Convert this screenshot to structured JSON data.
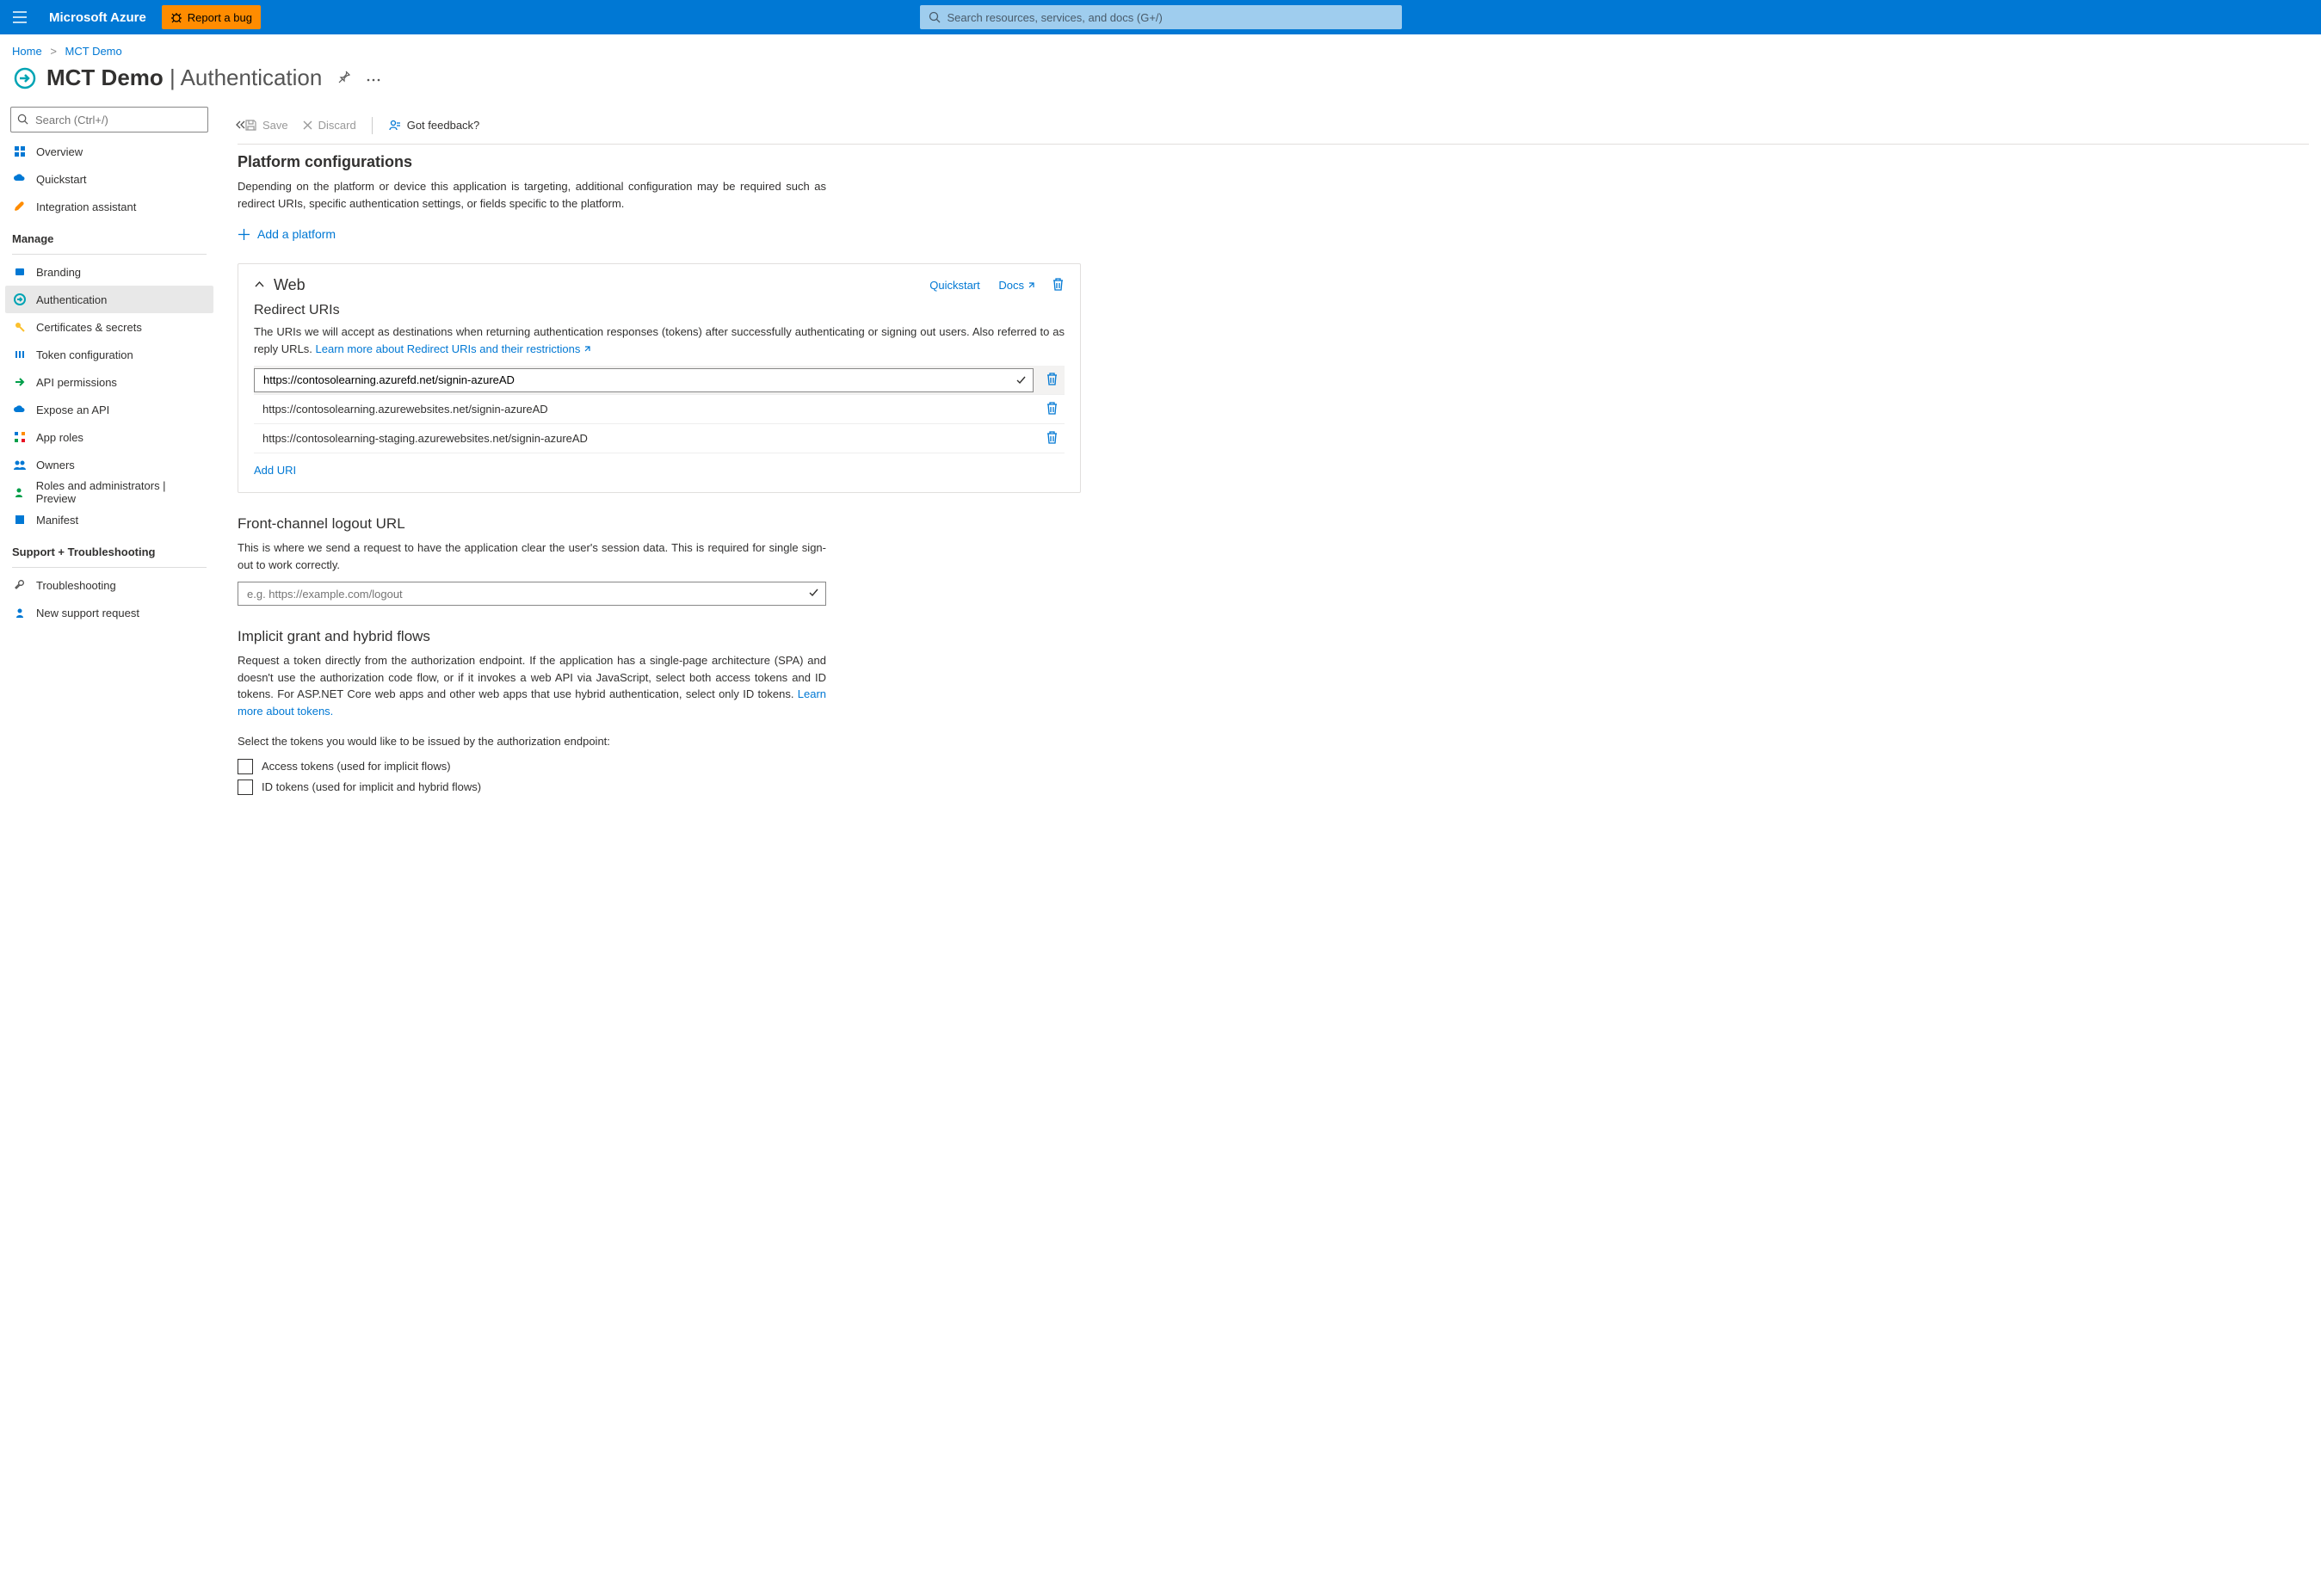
{
  "topbar": {
    "brand": "Microsoft Azure",
    "bug": "Report a bug",
    "search_ph": "Search resources, services, and docs (G+/)"
  },
  "crumbs": {
    "home": "Home",
    "page": "MCT Demo"
  },
  "header": {
    "app": "MCT Demo",
    "section": "Authentication"
  },
  "sidebar": {
    "search_ph": "Search (Ctrl+/)",
    "items_top": [
      {
        "label": "Overview"
      },
      {
        "label": "Quickstart"
      },
      {
        "label": "Integration assistant"
      }
    ],
    "group_manage": "Manage",
    "items_manage": [
      {
        "label": "Branding"
      },
      {
        "label": "Authentication"
      },
      {
        "label": "Certificates & secrets"
      },
      {
        "label": "Token configuration"
      },
      {
        "label": "API permissions"
      },
      {
        "label": "Expose an API"
      },
      {
        "label": "App roles"
      },
      {
        "label": "Owners"
      },
      {
        "label": "Roles and administrators | Preview"
      },
      {
        "label": "Manifest"
      }
    ],
    "group_support": "Support + Troubleshooting",
    "items_support": [
      {
        "label": "Troubleshooting"
      },
      {
        "label": "New support request"
      }
    ]
  },
  "cmdbar": {
    "save": "Save",
    "discard": "Discard",
    "feedback": "Got feedback?"
  },
  "platform": {
    "title": "Platform configurations",
    "desc": "Depending on the platform or device this application is targeting, additional configuration may be required such as redirect URIs, specific authentication settings, or fields specific to the platform.",
    "add": "Add a platform"
  },
  "web": {
    "title": "Web",
    "quickstart": "Quickstart",
    "docs": "Docs",
    "redirect_title": "Redirect URIs",
    "redirect_desc": "The URIs we will accept as destinations when returning authentication responses (tokens) after successfully authenticating or signing out users. Also referred to as reply URLs. ",
    "redirect_link": "Learn more about Redirect URIs and their restrictions",
    "uris": [
      "https://contosolearning.azurefd.net/signin-azureAD",
      "https://contosolearning.azurewebsites.net/signin-azureAD",
      "https://contosolearning-staging.azurewebsites.net/signin-azureAD"
    ],
    "add_uri": "Add URI"
  },
  "logout": {
    "title": "Front-channel logout URL",
    "desc": "This is where we send a request to have the application clear the user's session data. This is required for single sign-out to work correctly.",
    "ph": "e.g. https://example.com/logout"
  },
  "implicit": {
    "title": "Implicit grant and hybrid flows",
    "desc1": "Request a token directly from the authorization endpoint. If the application has a single-page architecture (SPA) and doesn't use the authorization code flow, or if it invokes a web API via JavaScript, select both access tokens and ID tokens. For ASP.NET Core web apps and other web apps that use hybrid authentication, select only ID tokens. ",
    "link": "Learn more about tokens.",
    "select": "Select the tokens you would like to be issued by the authorization endpoint:",
    "cb1": "Access tokens (used for implicit flows)",
    "cb2": "ID tokens (used for implicit and hybrid flows)"
  }
}
